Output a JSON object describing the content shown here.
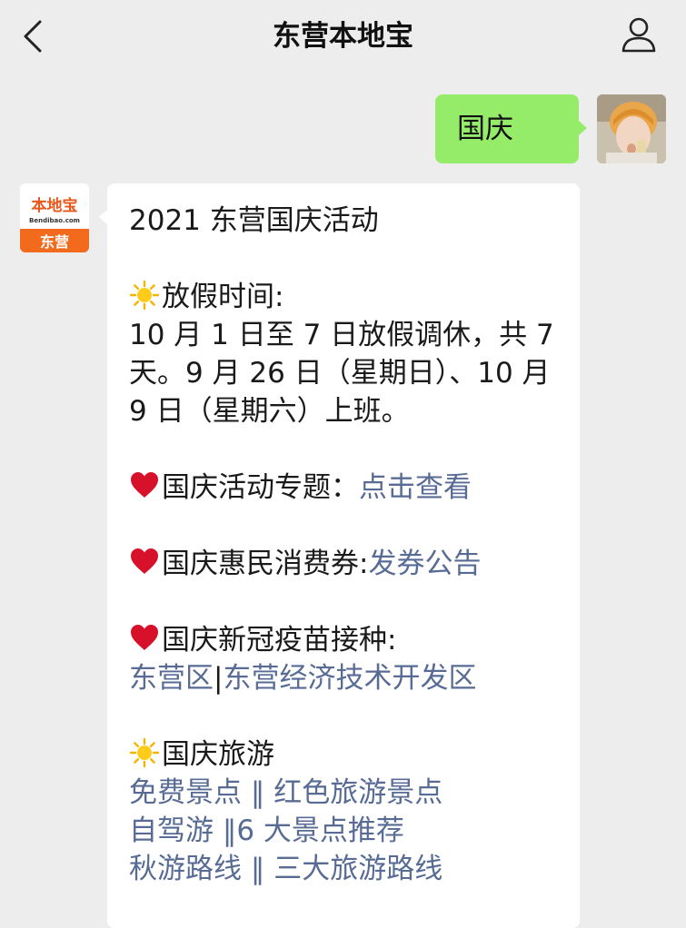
{
  "header": {
    "title": "东营本地宝",
    "back_icon": "chevron-left-icon",
    "profile_icon": "person-icon"
  },
  "outgoing": {
    "text": "国庆"
  },
  "incoming": {
    "avatar_logo": {
      "line1": "本地宝",
      "line2": "Bendibao.com",
      "line3": "东营"
    },
    "title": "2021 东营国庆活动",
    "holiday": {
      "icon": "sun-icon",
      "heading": "放假时间:",
      "body": "10 月 1 日至 7 日放假调休，共 7 天。9 月 26 日（星期日）、10 月 9 日（星期六）上班。"
    },
    "topic": {
      "icon": "heart-icon",
      "label": "国庆活动专题：",
      "link": "点击查看"
    },
    "coupon": {
      "icon": "heart-icon",
      "label": "国庆惠民消费券:",
      "link": "发券公告"
    },
    "vaccine": {
      "icon": "heart-icon",
      "label": "国庆新冠疫苗接种:",
      "link1": "东营区",
      "sep": "|",
      "link2": "东营经济技术开发区"
    },
    "travel": {
      "icon": "sun-icon",
      "heading": "国庆旅游",
      "row1": {
        "a": "免费景点",
        "sep": " ‖ ",
        "b": "红色旅游景点"
      },
      "row2": {
        "a": "自驾游",
        "sep": " ‖",
        "b": "6 大景点推荐"
      },
      "row3": {
        "a": "秋游路线",
        "sep": " ‖ ",
        "b": "三大旅游路线"
      }
    }
  },
  "colors": {
    "background": "#ededed",
    "outgoing_bubble": "#95ec69",
    "incoming_bubble": "#ffffff",
    "link": "#576b95",
    "brand_orange": "#f26a1b"
  }
}
